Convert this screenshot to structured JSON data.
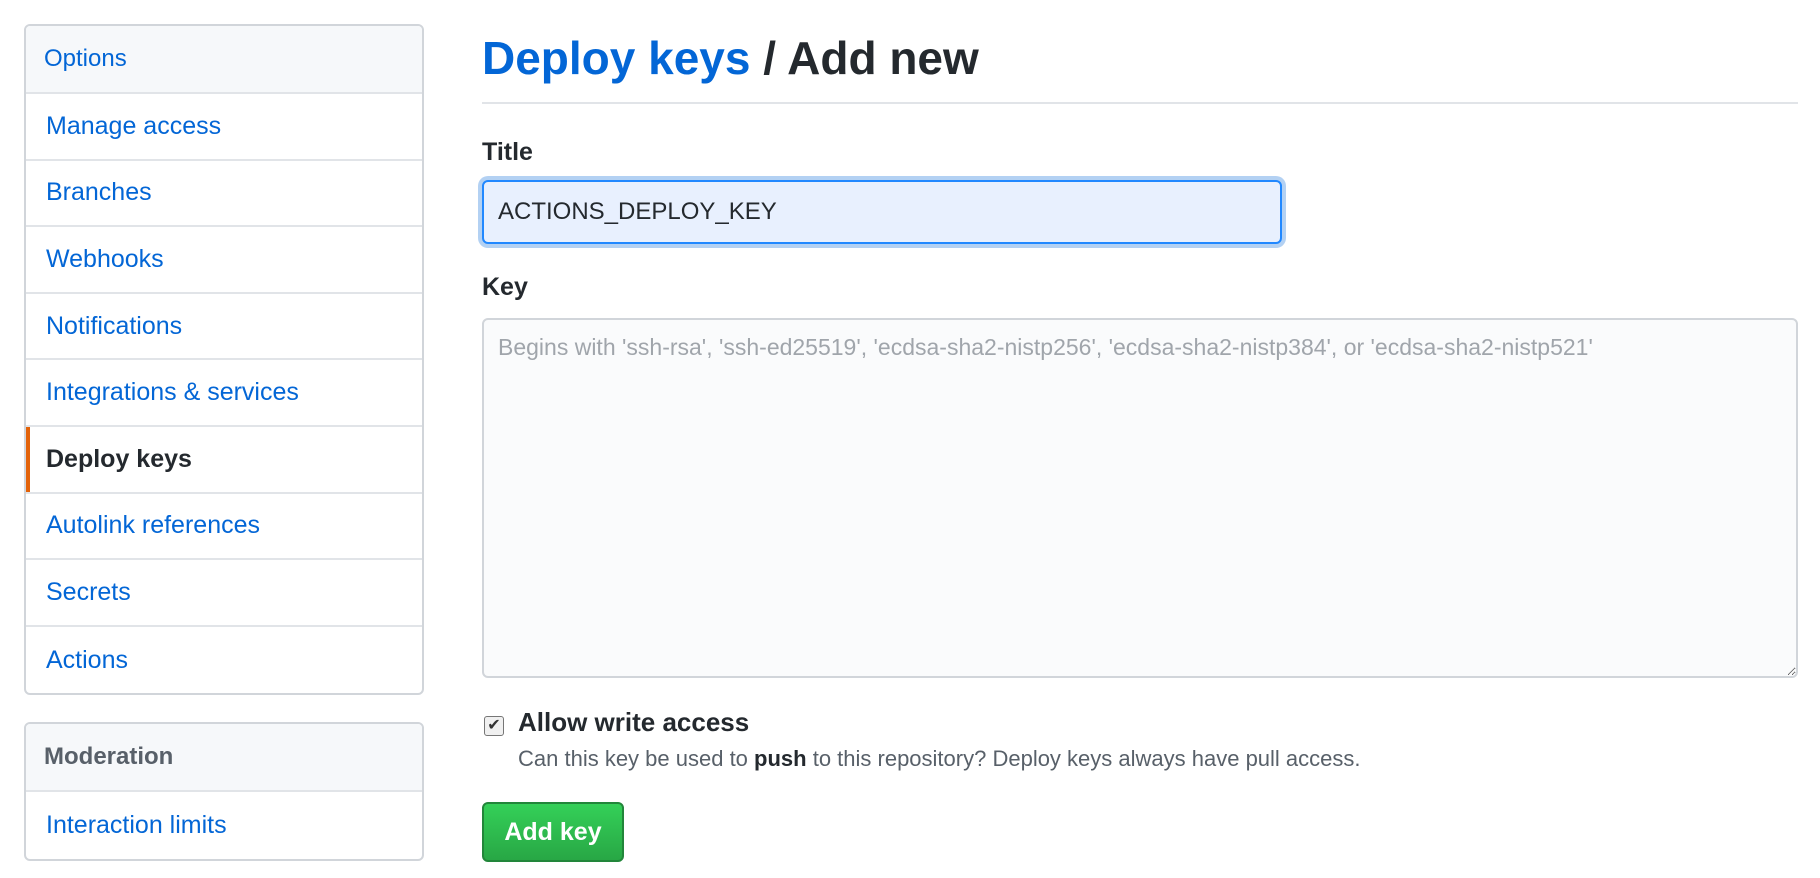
{
  "sidebar": {
    "options_heading": "Options",
    "items": [
      {
        "label": "Manage access"
      },
      {
        "label": "Branches"
      },
      {
        "label": "Webhooks"
      },
      {
        "label": "Notifications"
      },
      {
        "label": "Integrations & services"
      },
      {
        "label": "Deploy keys",
        "selected": true
      },
      {
        "label": "Autolink references"
      },
      {
        "label": "Secrets"
      },
      {
        "label": "Actions"
      }
    ],
    "moderation_heading": "Moderation",
    "moderation_items": [
      {
        "label": "Interaction limits"
      }
    ],
    "selected_indicator_color": "#e36209"
  },
  "header": {
    "breadcrumb_link": "Deploy keys",
    "separator": "/",
    "current": "Add new"
  },
  "form": {
    "title_label": "Title",
    "title_value": "ACTIONS_DEPLOY_KEY",
    "key_label": "Key",
    "key_value": "",
    "key_placeholder": "Begins with 'ssh-rsa', 'ssh-ed25519', 'ecdsa-sha2-nistp256', 'ecdsa-sha2-nistp384', or 'ecdsa-sha2-nistp521'",
    "write_access_checked": true,
    "write_access_label": "Allow write access",
    "note_before": "Can this key be used to ",
    "note_bold": "push",
    "note_after": " to this repository? Deploy keys always have pull access.",
    "submit_label": "Add key"
  },
  "colors": {
    "link": "#0366d6",
    "primary_button": "#28a745",
    "focus_ring": "#2188ff"
  }
}
